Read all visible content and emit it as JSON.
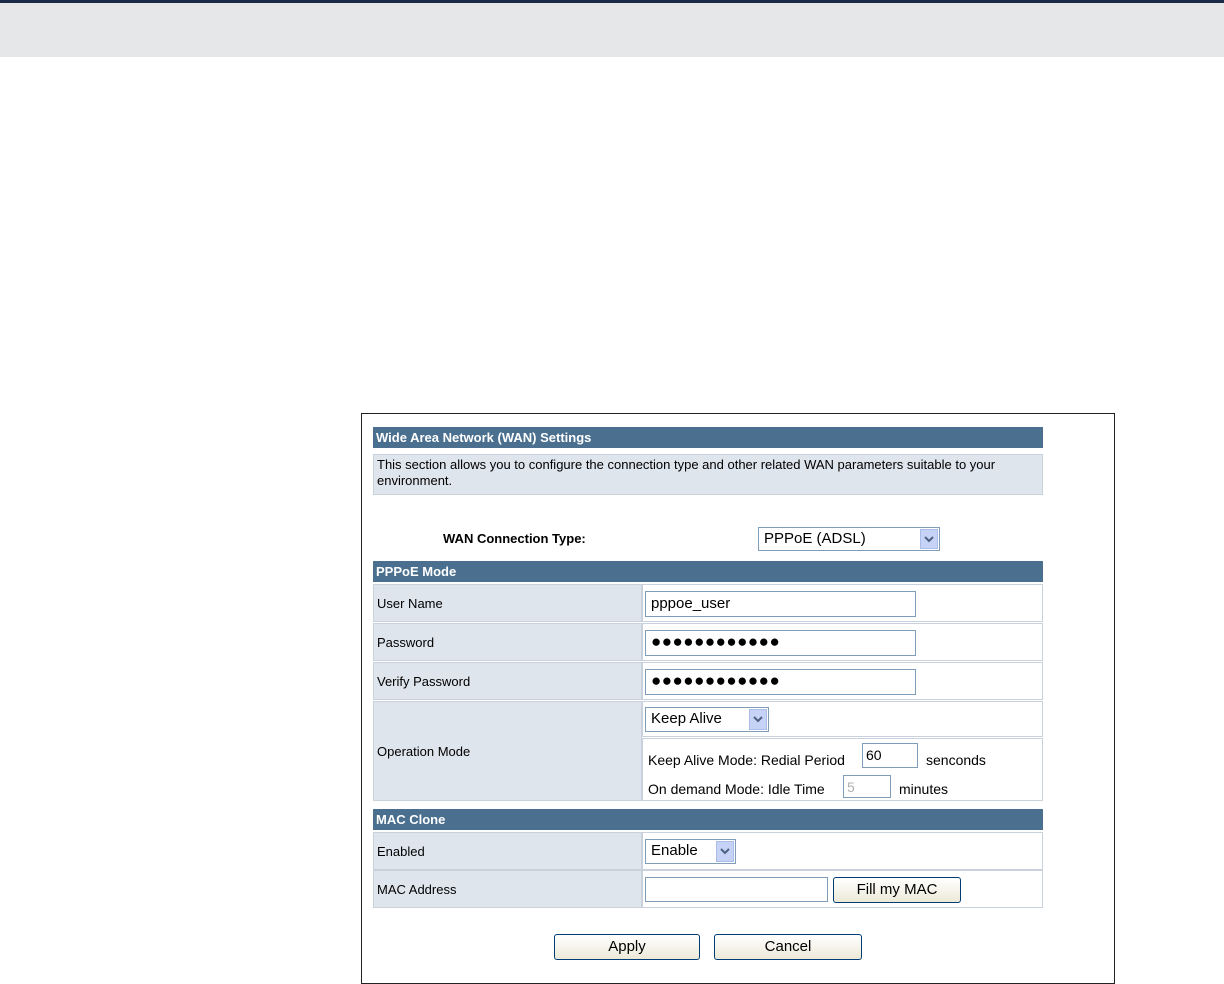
{
  "panel": {
    "title": "Wide Area Network (WAN) Settings",
    "description": "This section allows you to configure the connection type and other related WAN parameters suitable to your environment.",
    "connection_type_label": "WAN Connection Type:",
    "connection_type_value": "PPPoE (ADSL)"
  },
  "pppoe": {
    "header": "PPPoE Mode",
    "username_label": "User Name",
    "username_value": "pppoe_user",
    "password_label": "Password",
    "password_value": "●●●●●●●●●●●●",
    "verify_label": "Verify Password",
    "verify_value": "●●●●●●●●●●●●",
    "operation_label": "Operation Mode",
    "operation_value": "Keep Alive",
    "keep_alive_label": "Keep Alive Mode: Redial Period",
    "keep_alive_value": "60",
    "keep_alive_unit": "senconds",
    "on_demand_label": "On demand Mode: Idle Time",
    "on_demand_value": "5",
    "on_demand_unit": "minutes"
  },
  "mac_clone": {
    "header": "MAC Clone",
    "enabled_label": "Enabled",
    "enabled_value": "Enable",
    "mac_label": "MAC Address",
    "mac_value": "",
    "fill_button": "Fill my MAC"
  },
  "actions": {
    "apply": "Apply",
    "cancel": "Cancel"
  },
  "colors": {
    "header_bg": "#4a6f8f",
    "label_bg": "#dfe5ed",
    "top_band": "#e6e7e8"
  }
}
